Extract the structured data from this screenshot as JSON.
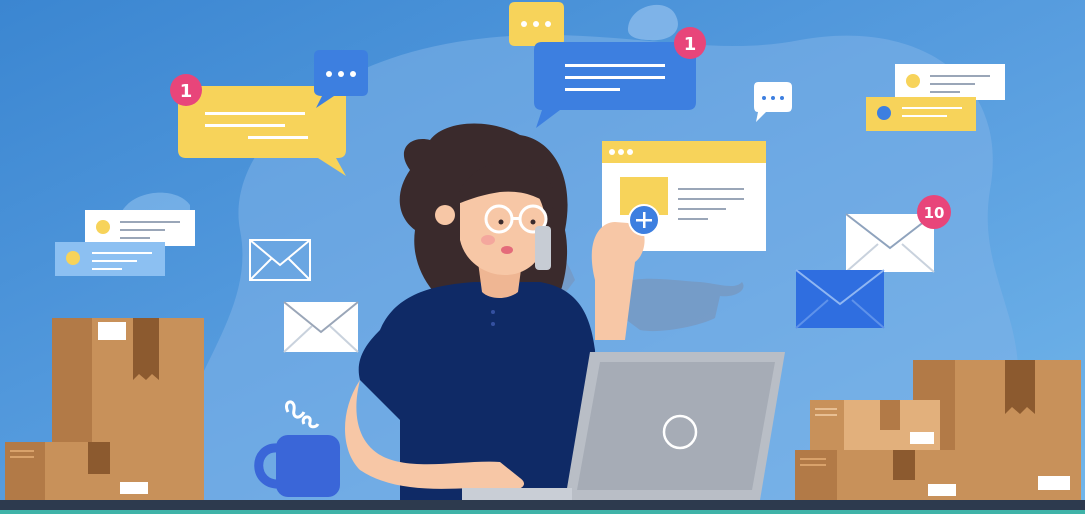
{
  "badges": {
    "yellow_bubble_count": "1",
    "blue_bubble_count": "1",
    "envelope_count": "10"
  },
  "colors": {
    "background": "#4a8fd6",
    "blob": "#7fb3e8",
    "bubble_yellow": "#f7d35a",
    "bubble_blue": "#3d7fe0",
    "badge_pink": "#e8457a",
    "box_tan": "#c8915a",
    "shirt_navy": "#0f2a66",
    "hair": "#3a2a2c",
    "skin": "#f7c7a6",
    "laptop": "#b9bec6",
    "mug": "#3a66d8"
  },
  "icons": [
    "chat-bubble-icon",
    "envelope-icon",
    "browser-window-icon",
    "plus-icon",
    "package-box-icon",
    "coffee-mug-icon",
    "laptop-icon",
    "notification-badge-icon"
  ]
}
